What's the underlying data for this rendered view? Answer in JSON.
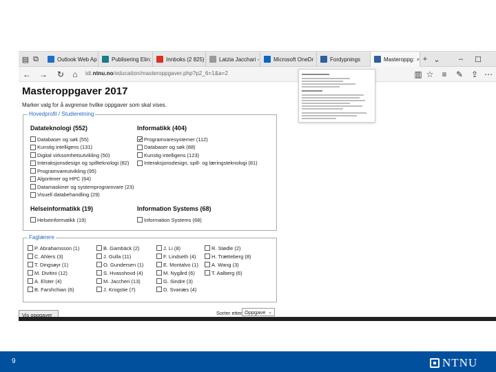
{
  "browser": {
    "tabs": [
      {
        "label": "Outlook Web Ap",
        "icon": "outlook-icon",
        "color": "#1e6fc7"
      },
      {
        "label": "Publisering Elin:",
        "icon": "sharepoint-icon",
        "color": "#1d7a86"
      },
      {
        "label": "Innboks (2 825) -",
        "icon": "gmail-icon",
        "color": "#d93025"
      },
      {
        "label": "Latzia Jacchari -",
        "icon": "page-icon",
        "color": "#9a9a9a"
      },
      {
        "label": "Microsoft OneDr",
        "icon": "onedrive-icon",
        "color": "#0a64c8"
      },
      {
        "label": "Fordypnings",
        "icon": "page-icon",
        "color": "#2e5f9e"
      },
      {
        "label": "Masteroppg:",
        "icon": "page-icon",
        "color": "#2e5f9e",
        "active": true
      }
    ],
    "url_prefix": "idi.",
    "url_domain": "ntnu.no",
    "url_rest": "/education/masteroppgaver.php?p2_6=1&a=2"
  },
  "page": {
    "title": "Masteroppgaver 2017",
    "instructions": "Marker valg for å avgrense hvilke oppgaver som skal vises.",
    "study_legend": "Hovedprofil / Studieretning",
    "groups": [
      {
        "heading": "Datateknologi (552)",
        "items": [
          {
            "label": "Databaser og søk (55)",
            "checked": false
          },
          {
            "label": "Kunstig intelligens (131)",
            "checked": false
          },
          {
            "label": "Digital virksomhetsutvikling (50)",
            "checked": false
          },
          {
            "label": "Interaksjonsdesign og spillteknologi (82)",
            "checked": false
          },
          {
            "label": "Programvareutvikling (95)",
            "checked": false
          },
          {
            "label": "Algoritmer og HPC (64)",
            "checked": false
          },
          {
            "label": "Datamaskiner og systemprogramvare (23)",
            "checked": false
          },
          {
            "label": "Visuell databehandling (29)",
            "checked": false
          }
        ]
      },
      {
        "heading": "Informatikk (404)",
        "items": [
          {
            "label": "Programvaresystemer (112)",
            "checked": true
          },
          {
            "label": "Databaser og søk (88)",
            "checked": false
          },
          {
            "label": "Kunstig intelligens (123)",
            "checked": false
          },
          {
            "label": "Interaksjonsdesign, spill- og læringsteknologi (81)",
            "checked": false
          }
        ]
      },
      {
        "heading": "Helseinformatikk (19)",
        "items": [
          {
            "label": "Helseinformatikk (19)",
            "checked": false
          }
        ]
      },
      {
        "heading": "Information Systems (68)",
        "items": [
          {
            "label": "Information Systems (68)",
            "checked": false
          }
        ]
      }
    ],
    "teachers_legend": "Faglærere",
    "teachers": [
      [
        "P. Abrahamsson (1)",
        "B. Gambäck (2)",
        "J. Li (8)",
        "R. Stødle (2)"
      ],
      [
        "C. Ahlers (3)",
        "J. Gulla (11)",
        "F. Lindseth (4)",
        "H. Trætteberg (8)"
      ],
      [
        "T. Dingsøyr (1)",
        "O. Gundersen (1)",
        "E. Montalvo (1)",
        "A. Wang (3)"
      ],
      [
        "M. Divitini (12)",
        "S. Hvasshovd (4)",
        "M. Nygård (6)",
        "T. Aalberg (6)"
      ],
      [
        "A. Elster (4)",
        "M. Jaccheri (13)",
        "G. Sindre (3)",
        ""
      ],
      [
        "B. Farshchian (6)",
        "J. Krogstie (7)",
        "D. Svanæs (4)",
        ""
      ]
    ],
    "sort_label": "Sorter etter:",
    "sort_value": "Oppgave",
    "show_button": "Vis oppgaver"
  },
  "footer": {
    "slide_number": "9",
    "logo_text": "NTNU",
    "color": "#00509e"
  }
}
